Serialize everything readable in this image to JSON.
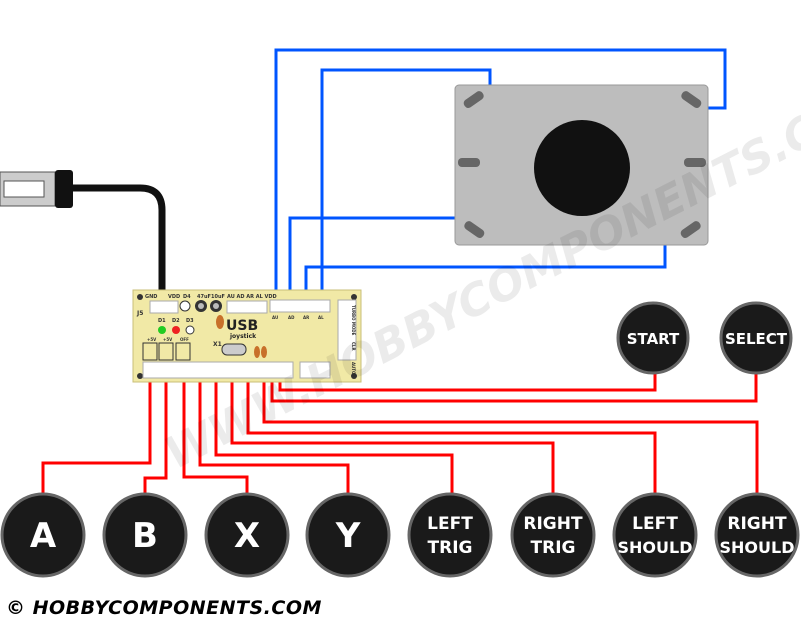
{
  "pcb": {
    "top_labels": [
      "GND",
      "VDD",
      "D4",
      "47uF",
      "10uF",
      "AU AD AR AL VDD"
    ],
    "j5": "J5",
    "leds": [
      "D1",
      "D2",
      "D3"
    ],
    "title": "USB",
    "subtitle": "joystick",
    "jumpers": [
      "+5V",
      "+5V",
      "OFF"
    ],
    "crystal": "X1",
    "dir_labels": [
      "AU",
      "AD",
      "AR",
      "AL"
    ],
    "side_labels": [
      "TURBO MODE",
      "CLR",
      "AUTO"
    ],
    "color": "#f1e9a6"
  },
  "buttons": [
    {
      "lines": [
        "A"
      ]
    },
    {
      "lines": [
        "B"
      ]
    },
    {
      "lines": [
        "X"
      ]
    },
    {
      "lines": [
        "Y"
      ]
    },
    {
      "lines": [
        "LEFT",
        "TRIG"
      ]
    },
    {
      "lines": [
        "RIGHT",
        "TRIG"
      ]
    },
    {
      "lines": [
        "LEFT",
        "SHOULD"
      ]
    },
    {
      "lines": [
        "RIGHT",
        "SHOULD"
      ]
    }
  ],
  "small_buttons": [
    {
      "label": "START"
    },
    {
      "label": "SELECT"
    }
  ],
  "colors": {
    "button_wire": "#ff0000",
    "joystick_wire": "#0055ff",
    "button": "#1a1a1a"
  },
  "watermark": "WWW.HOBBYCOMPONENTS.COM",
  "footer": "© HOBBYCOMPONENTS.COM"
}
